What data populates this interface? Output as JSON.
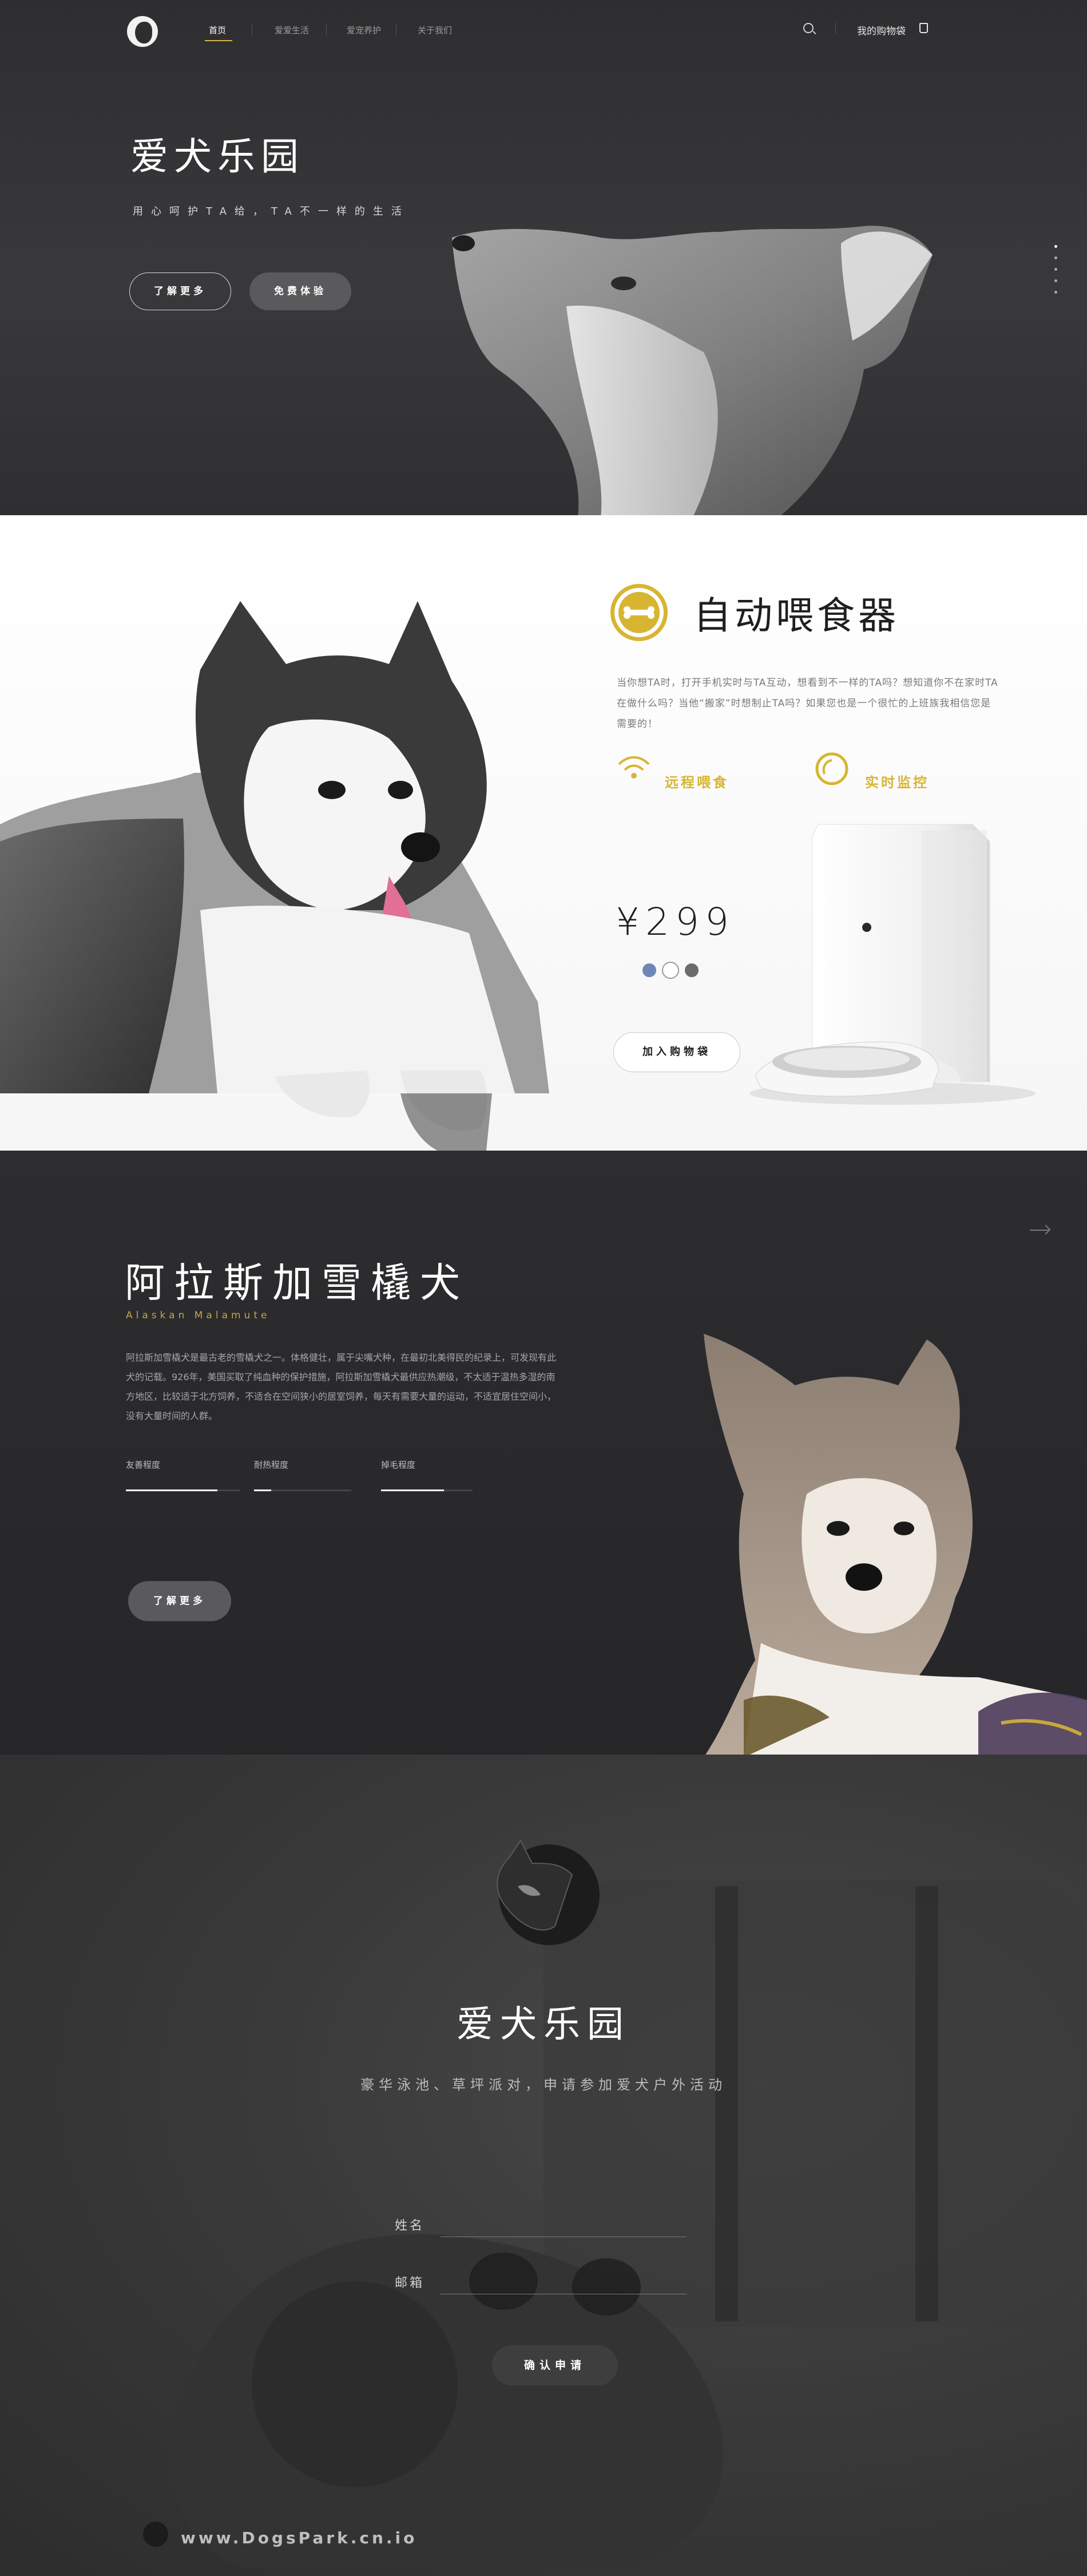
{
  "nav": {
    "items": [
      {
        "label": "首页",
        "active": true
      },
      {
        "label": "爱爱生活",
        "active": false
      },
      {
        "label": "爱宠养护",
        "active": false
      },
      {
        "label": "关于我们",
        "active": false
      }
    ],
    "cart_label": "我的购物袋",
    "search_icon": "search-icon",
    "cart_icon": "shopping-bag-icon"
  },
  "hero": {
    "title": "爱犬乐园",
    "subtitle": "用心呵护TA给，TA不一样的生活",
    "learn_more": "了解更多",
    "free_trial": "免费体验",
    "slide_count": 5,
    "active_slide": 1
  },
  "product": {
    "title": "自动喂食器",
    "description": "当你想TA时，打开手机实时与TA互动，想看到不一样的TA吗？想知道你不在家时TA在做什么吗？当他“搬家”时想制止TA吗？如果您也是一个很忙的上班族我相信您是需要的！",
    "feature_1": "远程喂食",
    "feature_2": "实时监控",
    "price": "¥299",
    "colors": [
      "#6f86b8",
      "#ffffff",
      "#6b6b6b"
    ],
    "add_to_cart": "加入购物袋",
    "icons": {
      "badge": "bone-icon",
      "f1": "wifi-icon",
      "f2": "monitor-icon"
    }
  },
  "breed": {
    "title": "阿拉斯加雪橇犬",
    "english": "Alaskan Malamute",
    "description": "阿拉斯加雪橇犬是最古老的雪橇犬之一。体格健壮，属于尖嘴犬种，在最初北美得民的纪录上，可发现有此犬的记载。926年，美国买取了纯血种的保护措施，阿拉斯加雪橇犬最供应热潮级，不太适于温热多湿的南方地区，比较适于北方饲养，不适合在空间狭小的居室饲养，每天有需要大量的运动，不适宜居住空间小，没有大量时间的人群。",
    "stats": [
      {
        "label": "友善程度",
        "value": 0.75
      },
      {
        "label": "耐热程度",
        "value": 0.15
      },
      {
        "label": "掉毛程度",
        "value": 0.7
      }
    ],
    "learn_more": "了解更多"
  },
  "event": {
    "title": "爱犬乐园",
    "subtitle": "豪华泳池、草坪派对，申请参加爱犬户外活动",
    "name_label": "姓名",
    "email_label": "邮箱",
    "name_value": "",
    "email_value": "",
    "submit": "确认申请"
  },
  "footer": {
    "url": "www.DogsPark.cn.io"
  }
}
